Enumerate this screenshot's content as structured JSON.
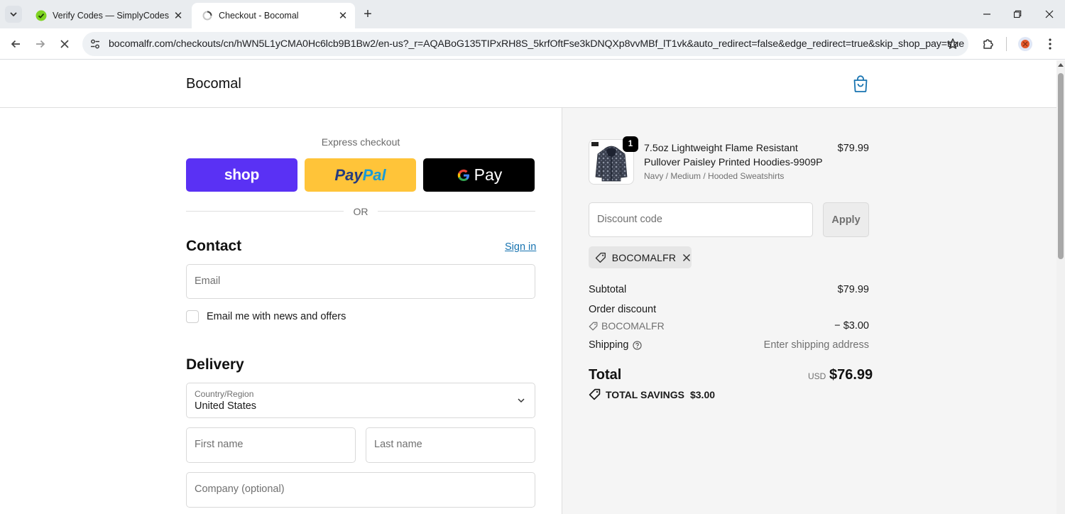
{
  "browser": {
    "tabs": [
      {
        "title": "Verify Codes — SimplyCodes",
        "active": false
      },
      {
        "title": "Checkout - Bocomal",
        "active": true
      }
    ],
    "url": "bocomalfr.com/checkouts/cn/hWN5L1yCMA0Hc6lcb9B1Bw2/en-us?_r=AQABoG135TIPxRH8S_5krfOftFse3kDNQXp8vvMBf_lT1vk&auto_redirect=false&edge_redirect=true&skip_shop_pay=true"
  },
  "header": {
    "brand": "Bocomal"
  },
  "express": {
    "title": "Express checkout",
    "shop_label": "shop",
    "paypal_label_1": "Pay",
    "paypal_label_2": "Pal",
    "gpay_label": "Pay",
    "or_label": "OR"
  },
  "contact": {
    "title": "Contact",
    "sign_in": "Sign in",
    "email_placeholder": "Email",
    "newsletter_label": "Email me with news and offers"
  },
  "delivery": {
    "title": "Delivery",
    "country_label": "Country/Region",
    "country_value": "United States",
    "first_name_placeholder": "First name",
    "last_name_placeholder": "Last name",
    "company_placeholder": "Company (optional)"
  },
  "summary": {
    "item": {
      "quantity": "1",
      "name": "7.5oz Lightweight Flame Resistant Pullover Paisley Printed Hoodies-9909P",
      "variant": "Navy / Medium / Hooded Sweatshirts",
      "price": "$79.99"
    },
    "discount_placeholder": "Discount code",
    "apply_label": "Apply",
    "applied_code": "BOCOMALFR",
    "subtotal_label": "Subtotal",
    "subtotal_value": "$79.99",
    "order_discount_label": "Order discount",
    "order_discount_code": "BOCOMALFR",
    "order_discount_value": "− $3.00",
    "shipping_label": "Shipping",
    "shipping_value": "Enter shipping address",
    "total_label": "Total",
    "total_currency": "USD",
    "total_value": "$76.99",
    "savings_label": "TOTAL SAVINGS",
    "savings_value": "$3.00"
  },
  "colors": {
    "shop_purple": "#5a31f4",
    "paypal_yellow": "#ffc439",
    "link_blue": "#1773b0"
  }
}
